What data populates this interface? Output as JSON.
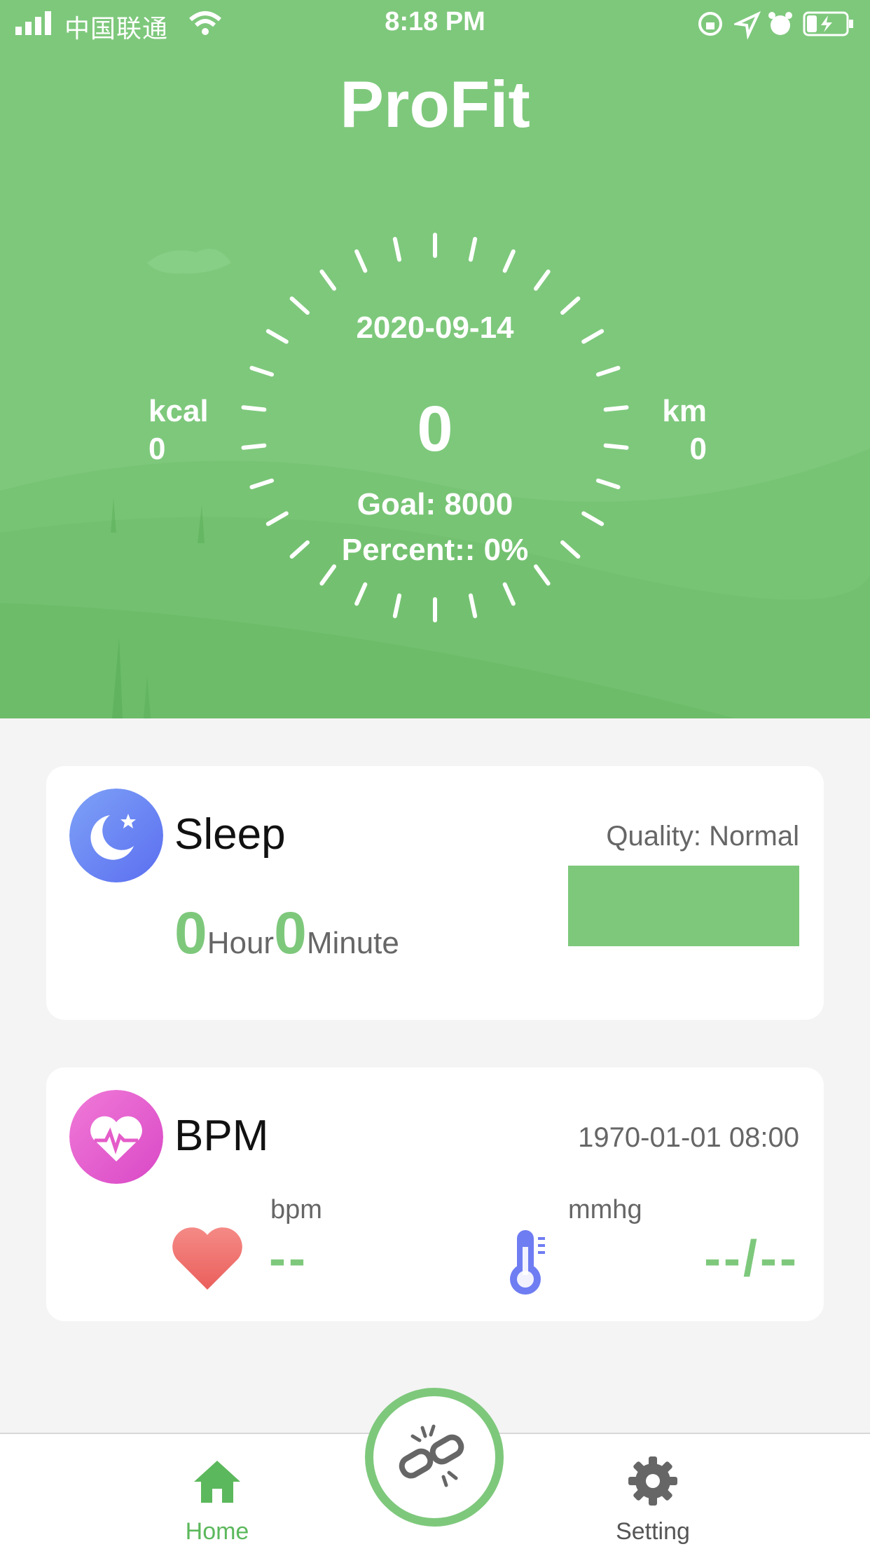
{
  "status_bar": {
    "carrier": "中国联通",
    "time": "8:18 PM"
  },
  "header": {
    "title": "ProFit"
  },
  "dial": {
    "date": "2020-09-14",
    "steps": "0",
    "goal": "Goal: 8000",
    "percent": "Percent:: 0%",
    "kcal_label": "kcal",
    "kcal_value": "0",
    "km_label": "km",
    "km_value": "0"
  },
  "sleep": {
    "title": "Sleep",
    "quality": "Quality: Normal",
    "hours": "0",
    "hour_unit": "Hour",
    "minutes": "0",
    "minute_unit": "Minute"
  },
  "bpm": {
    "title": "BPM",
    "timestamp": "1970-01-01 08:00",
    "bpm_label": "bpm",
    "bpm_value": "--",
    "pressure_label": "mmhg",
    "pressure_value": "--/--"
  },
  "tabbar": {
    "home_label": "Home",
    "setting_label": "Setting"
  },
  "icons": {
    "connect": "broken-link-icon",
    "home": "home-icon",
    "setting": "gear-icon",
    "sleep": "moon-icon",
    "bpm": "heartbeat-icon",
    "heart": "heart-icon",
    "thermometer": "thermometer-icon"
  },
  "colors": {
    "accent": "#7ec87c",
    "home_active": "#5cb85c"
  }
}
